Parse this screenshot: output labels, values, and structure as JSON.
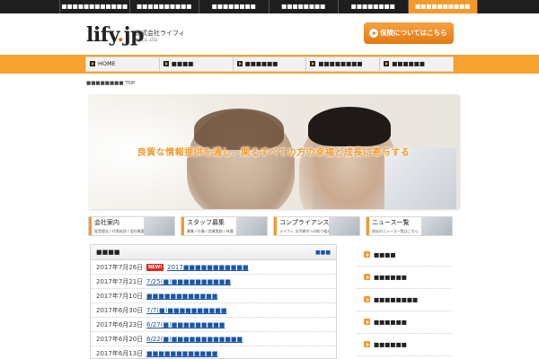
{
  "top_nav": {
    "items": [
      {
        "label": "■■■■■■■■■■■■",
        "active": false
      },
      {
        "label": "■■■■■■■■■■",
        "active": false
      },
      {
        "label": "■■■■■■■■",
        "active": false
      },
      {
        "label": "■■■■■■■■",
        "active": false
      },
      {
        "label": "■■■■■■■■",
        "active": false
      },
      {
        "label": "■■■■■■■■■■",
        "active": true
      }
    ]
  },
  "header": {
    "logo_main": "lify",
    "logo_dot": ".",
    "logo_tld": "jp",
    "company_jp": "株式会社ライフィ",
    "company_en": "lify Co.,LTD.",
    "insure_button": "保険についてはこちら"
  },
  "main_nav": {
    "items": [
      "HOME",
      "■■■■",
      "■■■■■■",
      "■■■■■■■■",
      "■■■■■■"
    ]
  },
  "breadcrumb": "■■■■■■■■ TOP",
  "hero": {
    "tagline": "良質な情報提供を通し、関るすべての方の幸福と成長に寄与する"
  },
  "banners": [
    {
      "title": "会社案内",
      "sub": "経営理念 / 代表挨拶 / 会社概要"
    },
    {
      "title": "スタッフ募集",
      "sub": "募集 / 仕事 / 営業実務 / 待遇"
    },
    {
      "title": "コンプライアンス",
      "sub": "ライフィ 法令順守への取り組み"
    },
    {
      "title": "ニュース一覧",
      "sub": "過去のニュース一覧はこちら"
    }
  ],
  "news": {
    "title": "■■■■",
    "more_label": "■■■",
    "new_badge": "NEW!",
    "rows": [
      {
        "date": "2017年7月26日",
        "text": "2017■■■■■■■■■■■",
        "is_new": true
      },
      {
        "date": "2017年7月21日",
        "text": "7/25(■)■■■■■■■■■■",
        "is_new": false
      },
      {
        "date": "2017年7月10日",
        "text": "■■■■■■■■■■■■",
        "is_new": false
      },
      {
        "date": "2017年6月30日",
        "text": "7/7(■)■■■■■■■■■■",
        "is_new": false
      },
      {
        "date": "2017年6月23日",
        "text": "6/27(■)■■■■■■■■■",
        "is_new": false
      },
      {
        "date": "2017年6月20日",
        "text": "6/22(■)■■■■■■■■■■■■",
        "is_new": false
      },
      {
        "date": "2017年6月13日",
        "text": "■■■■■■■■■■■■",
        "is_new": false
      }
    ]
  },
  "side_menu": {
    "items": [
      "■■■■",
      "■■■■■■",
      "■■■■■■■■",
      "■■■■■■",
      "■■■■■■"
    ]
  },
  "colors": {
    "accent_orange": "#f39a2b",
    "topbar": "#1e1e1e",
    "link_blue": "#1a56a8",
    "new_red": "#e0241b"
  }
}
